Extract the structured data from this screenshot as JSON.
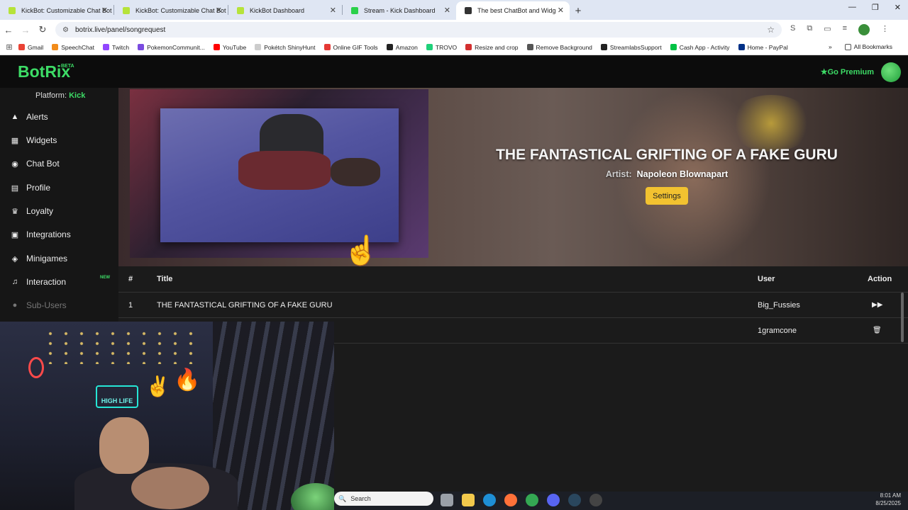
{
  "browser": {
    "tabs": [
      {
        "title": "KickBot: Customizable Chat Bot",
        "color": "#b6e33a",
        "active": false
      },
      {
        "title": "KickBot: Customizable Chat Bot",
        "color": "#b6e33a",
        "active": false
      },
      {
        "title": "KickBot Dashboard",
        "color": "#b6e33a",
        "active": false
      },
      {
        "title": "Stream - Kick Dashboard",
        "color": "#2bd14a",
        "active": false
      },
      {
        "title": "The best ChatBot and Widg",
        "color": "#333333",
        "active": true
      }
    ],
    "url": "botrix.live/panel/songrequest",
    "bookmarks": [
      {
        "label": "Gmail",
        "color": "#ea4335"
      },
      {
        "label": "SpeechChat",
        "color": "#f28c1a"
      },
      {
        "label": "Twitch",
        "color": "#9146ff"
      },
      {
        "label": "PokemonCommunit...",
        "color": "#7a4be0"
      },
      {
        "label": "YouTube",
        "color": "#ff0000"
      },
      {
        "label": "Pokétch ShinyHunt",
        "color": "#cccccc"
      },
      {
        "label": "Online GIF Tools",
        "color": "#e53935"
      },
      {
        "label": "Amazon",
        "color": "#222222"
      },
      {
        "label": "TROVO",
        "color": "#1fd17a"
      },
      {
        "label": "Resize and crop",
        "color": "#d32f2f"
      },
      {
        "label": "Remove Background",
        "color": "#555555"
      },
      {
        "label": "StreamlabsSupport",
        "color": "#222222"
      },
      {
        "label": "Cash App - Activity",
        "color": "#00c244"
      },
      {
        "label": "Home - PayPal",
        "color": "#003087"
      }
    ],
    "all_bookmarks": "All Bookmarks"
  },
  "app": {
    "logo": "BotRix",
    "beta": "BETA",
    "premium": "Go Premium",
    "platform_label": "Platform:",
    "platform_value": "Kick",
    "nav": [
      {
        "label": "Alerts",
        "icon": "▲"
      },
      {
        "label": "Widgets",
        "icon": "▦"
      },
      {
        "label": "Chat Bot",
        "icon": "◉"
      },
      {
        "label": "Profile",
        "icon": "▤"
      },
      {
        "label": "Loyalty",
        "icon": "♛"
      },
      {
        "label": "Integrations",
        "icon": "▣"
      },
      {
        "label": "Minigames",
        "icon": "◈"
      },
      {
        "label": "Interaction",
        "icon": "♫"
      },
      {
        "label": "Sub-Users",
        "icon": "●"
      }
    ],
    "new_badge": "NEW"
  },
  "now_playing": {
    "title": "THE FANTASTICAL GRIFTING OF A FAKE GURU",
    "artist_label": "Artist:",
    "artist": "Napoleon Blownapart",
    "settings": "Settings"
  },
  "queue": {
    "headers": {
      "num": "#",
      "title": "Title",
      "user": "User",
      "action": "Action"
    },
    "rows": [
      {
        "num": "1",
        "title": "THE FANTASTICAL GRIFTING OF A FAKE GURU",
        "user": "Big_Fussies",
        "action": "▶▶"
      },
      {
        "num": "",
        "title": "",
        "user": "1gramcone",
        "action": "🗑"
      }
    ]
  },
  "webcam": {
    "neon_sign": "HIGH LIFE"
  },
  "taskbar": {
    "search": "Search",
    "time": "8:01 AM",
    "date": "8/25/2025"
  }
}
